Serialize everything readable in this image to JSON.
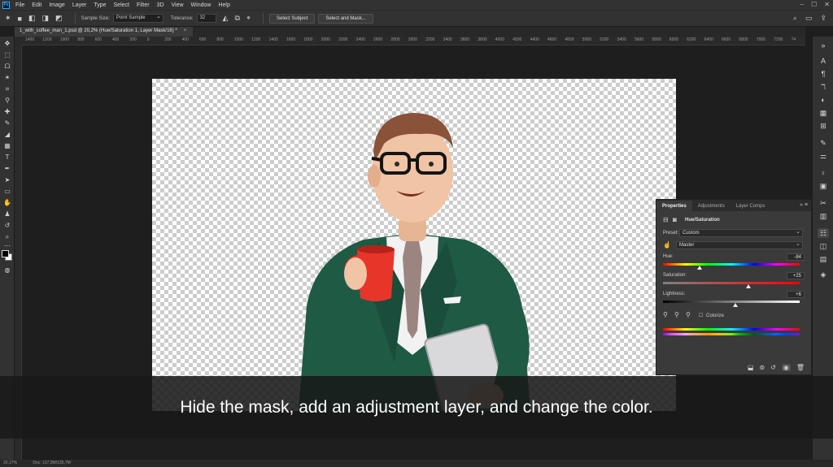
{
  "menubar": {
    "app_icon_text": "Ps",
    "items": [
      "File",
      "Edit",
      "Image",
      "Layer",
      "Type",
      "Select",
      "Filter",
      "3D",
      "View",
      "Window",
      "Help"
    ]
  },
  "options_bar": {
    "sample_size_label": "Sample Size:",
    "sample_size_value": "Point Sample",
    "tolerance_label": "Tolerance:",
    "tolerance_value": "32",
    "select_subject": "Select Subject",
    "select_and_mask": "Select and Mask..."
  },
  "document_tab": {
    "title": "1_with_coffee_man_1.psd @ 20,2% (Hue/Saturation 1, Layer Mask/16) *"
  },
  "ruler": {
    "labels": [
      "1400",
      "1200",
      "1000",
      "800",
      "600",
      "400",
      "200",
      "0",
      "200",
      "400",
      "600",
      "800",
      "1000",
      "1200",
      "1400",
      "1600",
      "1800",
      "2000",
      "2200",
      "2400",
      "2600",
      "2800",
      "3000",
      "3200",
      "3400",
      "3600",
      "3800",
      "4000",
      "4200",
      "4400",
      "4600",
      "4800",
      "5000",
      "5200",
      "5400",
      "5600",
      "5800",
      "6000",
      "6200",
      "6400",
      "6600",
      "6800",
      "7000",
      "7200",
      "74"
    ]
  },
  "properties": {
    "tabs": [
      "Properties",
      "Adjustments",
      "Layer Comps"
    ],
    "adjustment_title": "Hue/Saturation",
    "preset_label": "Preset:",
    "preset_value": "Custom",
    "channel_value": "Master",
    "hue_label": "Hue:",
    "hue_value": "-84",
    "saturation_label": "Saturation:",
    "saturation_value": "+25",
    "lightness_label": "Lightness:",
    "lightness_value": "+6",
    "colorize_label": "Colorize",
    "hue_level": -84,
    "saturation_level": 25,
    "lightness_level": 6
  },
  "status": {
    "zoom": "20,17%",
    "doc_size": "Doc: 137,3M/135,7M"
  },
  "caption": "Hide the mask, add an adjustment layer, and change the color.",
  "colors": {
    "accent": "#31a8ff",
    "jacket": "#1f5a45",
    "mug": "#e8352a"
  }
}
